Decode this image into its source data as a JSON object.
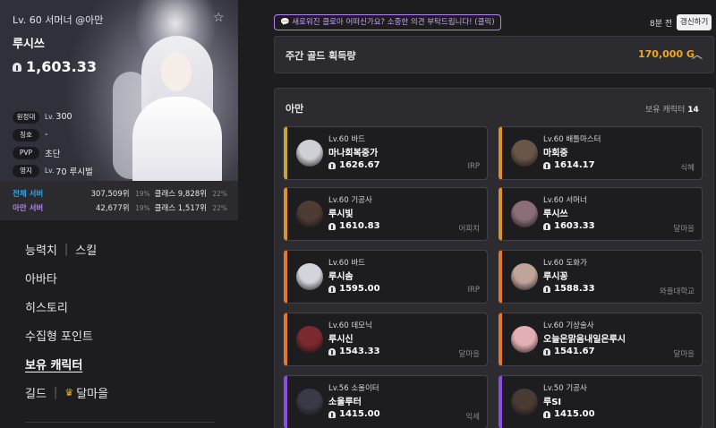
{
  "profile": {
    "level_server": "Lv. 60 서머너 @아만",
    "name": "루시쓰",
    "item_level": "1,603.33",
    "tags": [
      {
        "tag": "원정대",
        "prefix": "Lv.",
        "value": "300"
      },
      {
        "tag": "칭호",
        "prefix": "",
        "value": "-"
      },
      {
        "tag": "PVP",
        "prefix": "",
        "value": "초단"
      },
      {
        "tag": "영지",
        "prefix": "Lv.",
        "value": "70 루시벌"
      }
    ]
  },
  "ranks": [
    {
      "label": "전체 서버",
      "rank": "307,509위",
      "pct": "19%",
      "class_rank": "클래스 9,828위",
      "class_pct": "22%",
      "color": "#2fa6e8"
    },
    {
      "label": "아만 서버",
      "rank": "42,677위",
      "pct": "19%",
      "class_rank": "클래스 1,517위",
      "class_pct": "22%",
      "color": "#b181f2"
    }
  ],
  "menu": [
    {
      "label": "능력치",
      "label2": "스킬"
    },
    {
      "label": "아바타"
    },
    {
      "label": "히스토리"
    },
    {
      "label": "수집형 포인트"
    },
    {
      "label": "보유 캐릭터"
    },
    {
      "label": "길드",
      "label2": "달마을"
    }
  ],
  "top": {
    "notice": "새로워진 클로아 어떠신가요? 소중한 의견 부탁드립니다! (클릭)",
    "ago": "8분 전",
    "refresh": "갱신하기"
  },
  "gold": {
    "label": "주간 골드 획득량",
    "value": "170,000 G"
  },
  "roster": {
    "server": "아만",
    "count_label": "보유 캐릭터",
    "count": "14",
    "characters": [
      {
        "lv": "Lv.60 바드",
        "name": "마나회복중가",
        "ilvl": "1626.67",
        "guild": "IRP",
        "color": "#c7a437",
        "avatar": "#cfcfd6"
      },
      {
        "lv": "Lv.60 배틀마스터",
        "name": "마회중",
        "ilvl": "1614.17",
        "guild": "식혜",
        "color": "#e0902a",
        "avatar": "#6a5648"
      },
      {
        "lv": "Lv.60 기공사",
        "name": "루시빛",
        "ilvl": "1610.83",
        "guild": "어피치",
        "color": "#e0902a",
        "avatar": "#4e3b33"
      },
      {
        "lv": "Lv.60 서머너",
        "name": "루시쓰",
        "ilvl": "1603.33",
        "guild": "달마을",
        "color": "#e0902a",
        "avatar": "#8a6e78"
      },
      {
        "lv": "Lv.60 바드",
        "name": "루시솜",
        "ilvl": "1595.00",
        "guild": "IRP",
        "color": "#e07a2a",
        "avatar": "#d4d4dc"
      },
      {
        "lv": "Lv.60 도화가",
        "name": "루시꽁",
        "ilvl": "1588.33",
        "guild": "와플대학교",
        "color": "#e07a2a",
        "avatar": "#bfa49a"
      },
      {
        "lv": "Lv.60 데모닉",
        "name": "루시신",
        "ilvl": "1543.33",
        "guild": "달마을",
        "color": "#e07a2a",
        "avatar": "#7a2a2e"
      },
      {
        "lv": "Lv.60 기상술사",
        "name": "오늘은맑음내일은루시",
        "ilvl": "1541.67",
        "guild": "달마을",
        "color": "#e07a2a",
        "avatar": "#e2b0b4"
      },
      {
        "lv": "Lv.56 소울이터",
        "name": "소울루터",
        "ilvl": "1415.00",
        "guild": "익세",
        "color": "#8b4fe0",
        "avatar": "#3a3a44"
      },
      {
        "lv": "Lv.50 기공사",
        "name": "루SI",
        "ilvl": "1415.00",
        "guild": "",
        "color": "#8b4fe0",
        "avatar": "#4a3a34"
      }
    ]
  }
}
